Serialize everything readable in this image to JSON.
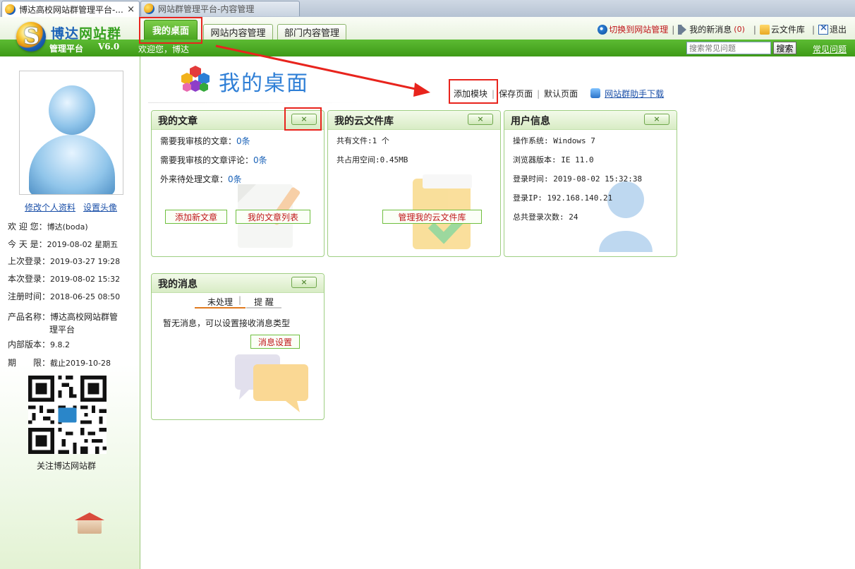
{
  "browser_tabs": [
    {
      "title": "博达高校网站群管理平台-...",
      "close": "×"
    },
    {
      "title": "网站群管理平台-内容管理"
    }
  ],
  "header": {
    "logo_letter": "S",
    "brand_part1": "博达",
    "brand_part2": "网站群",
    "platform": "管理平台",
    "version": "V6.0",
    "welcome": "欢迎您，博达"
  },
  "nav_tabs": [
    "我的桌面",
    "网站内容管理",
    "部门内容管理"
  ],
  "top_links": {
    "switch": "切换到网站管理",
    "messages": "我的新消息",
    "message_count": "(0)",
    "cloud": "云文件库",
    "exit": "退出"
  },
  "search": {
    "placeholder": "搜索常见问题",
    "button": "搜索"
  },
  "faq_link": "常见问题",
  "sidebar": {
    "edit_profile": "修改个人资料",
    "set_avatar": "设置头像",
    "info": [
      {
        "label": "欢 迎 您：",
        "value": "博达(boda)"
      },
      {
        "label": "今 天 是：",
        "value": "2019-08-02 星期五"
      },
      {
        "label": "上次登录：",
        "value": "2019-03-27 19:28"
      },
      {
        "label": "本次登录：",
        "value": "2019-08-02 15:32"
      },
      {
        "label": "注册时间：",
        "value": "2018-06-25 08:50"
      }
    ],
    "product_label": "产品名称：",
    "product_line1": "博达高校网站群管",
    "product_line2": "理平台",
    "internal_label": "内部版本：",
    "internal_value": "9.8.2",
    "expiry_label": "期　　限：",
    "expiry_value": "截止2019-10-28",
    "qr_label": "关注博达网站群"
  },
  "desk": {
    "title": "我的桌面",
    "add_module": "添加模块",
    "save_page": "保存页面",
    "default_page": "默认页面",
    "helper_download": "网站群助手下载"
  },
  "panels": {
    "articles": {
      "title": "我的文章",
      "close": "×",
      "rows": [
        {
          "label": "需要我审核的文章：",
          "count": "0条"
        },
        {
          "label": "需要我审核的文章评论：",
          "count": "0条"
        },
        {
          "label": "外来待处理文章：",
          "count": "0条"
        }
      ],
      "btn_new": "添加新文章",
      "btn_list": "我的文章列表"
    },
    "cloud": {
      "title": "我的云文件库",
      "close": "×",
      "files": "共有文件:1 个",
      "space": "共占用空间:0.45MB",
      "btn_manage": "管理我的云文件库"
    },
    "user": {
      "title": "用户信息",
      "close": "×",
      "os": "操作系统: Windows 7",
      "browser": "浏览器版本: IE 11.0",
      "login_time": "登录时间: 2019-08-02 15:32:38",
      "login_ip": "登录IP: 192.168.140.21",
      "login_count": "总共登录次数: 24"
    },
    "messages": {
      "title": "我的消息",
      "close": "×",
      "tab_pending": "未处理",
      "tab_remind": "提 醒",
      "empty": "暂无消息，可以设置接收消息类型",
      "btn_settings": "消息设置"
    }
  },
  "colors": {
    "green": "#4aa522",
    "blue": "#2f7fd6",
    "red_highlight": "#e8241d"
  }
}
